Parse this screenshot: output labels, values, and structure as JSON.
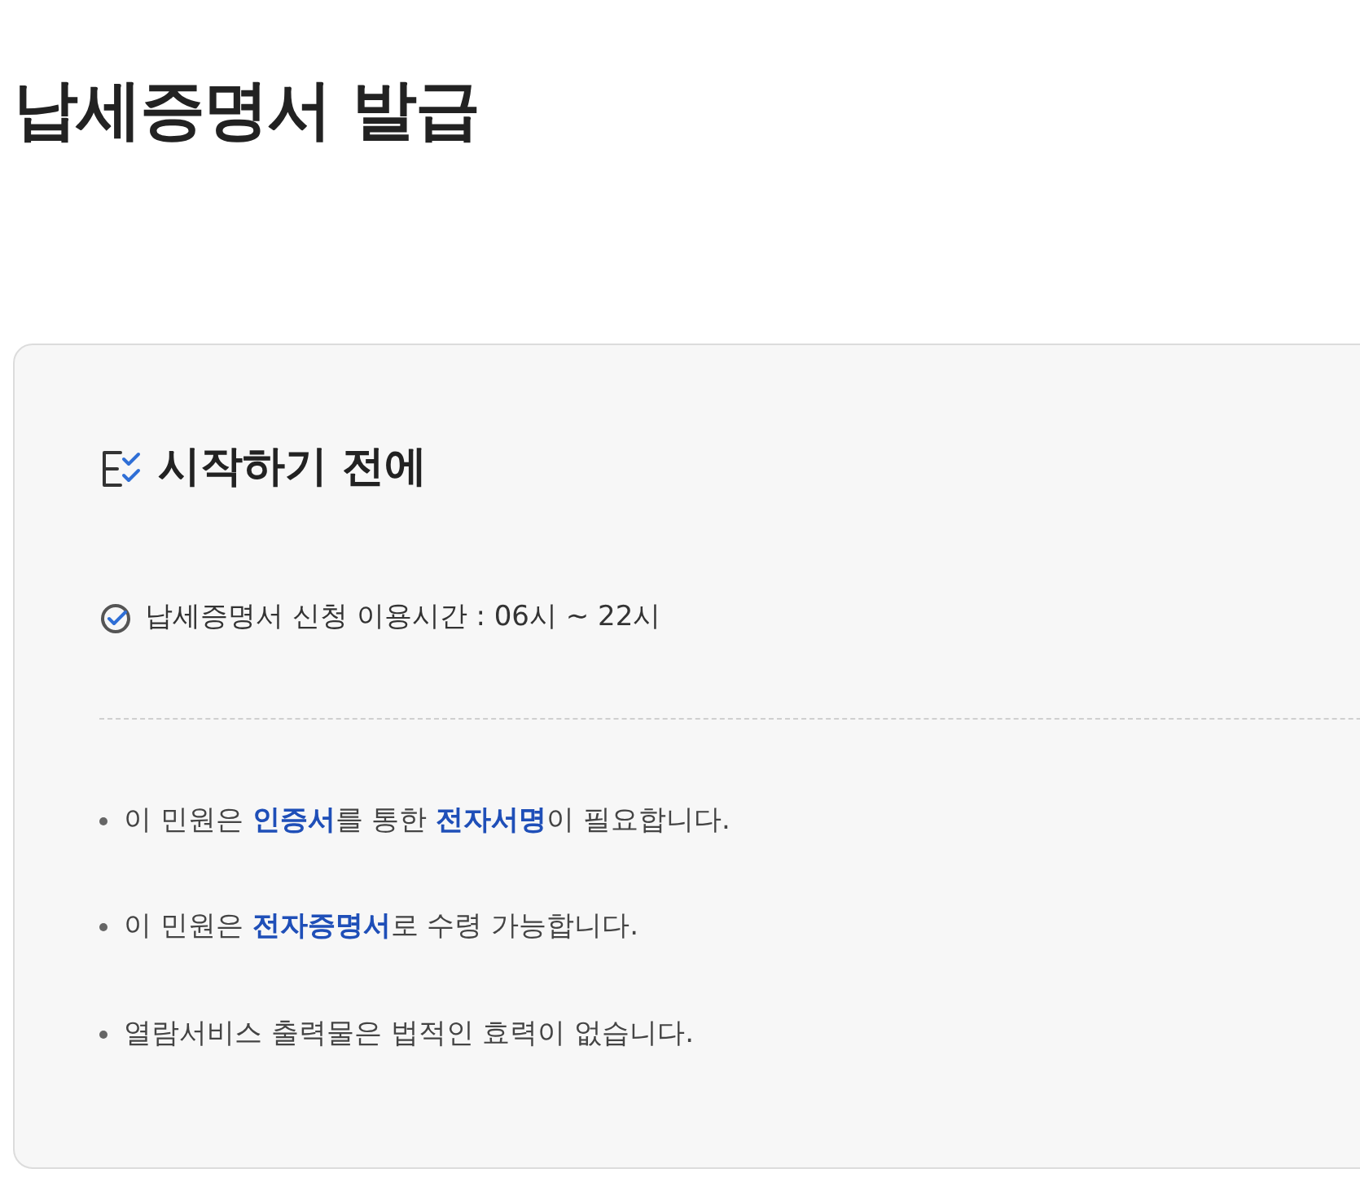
{
  "page_title": "납세증명서 발급",
  "notice": {
    "heading": "시작하기 전에",
    "hours": "납세증명서 신청 이용시간 : 06시 ~ 22시",
    "items": [
      "이 민원은 **인증서**를 통한 **전자서명**이 필요합니다.",
      "이 민원은 **전자증명서**로 수령 가능합니다.",
      "열람서비스 출력물은 법적인 효력이 없습니다."
    ]
  }
}
